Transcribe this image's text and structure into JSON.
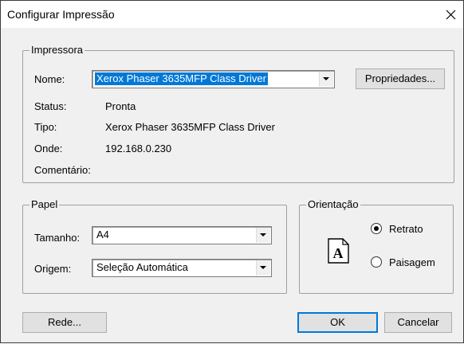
{
  "window": {
    "title": "Configurar Impressão"
  },
  "printer_group": {
    "legend": "Impressora",
    "name_label": "Nome:",
    "name_value": "Xerox Phaser 3635MFP Class Driver",
    "properties_button": "Propriedades...",
    "status_label": "Status:",
    "status_value": "Pronta",
    "type_label": "Tipo:",
    "type_value": "Xerox Phaser 3635MFP Class Driver",
    "where_label": "Onde:",
    "where_value": "192.168.0.230",
    "comment_label": "Comentário:",
    "comment_value": ""
  },
  "paper_group": {
    "legend": "Papel",
    "size_label": "Tamanho:",
    "size_value": "A4",
    "source_label": "Origem:",
    "source_value": "Seleção Automática"
  },
  "orientation_group": {
    "legend": "Orientação",
    "icon_letter": "A",
    "portrait_label": "Retrato",
    "portrait_selected": true,
    "landscape_label": "Paisagem",
    "landscape_selected": false
  },
  "buttons": {
    "network": "Rede...",
    "ok": "OK",
    "cancel": "Cancelar"
  }
}
